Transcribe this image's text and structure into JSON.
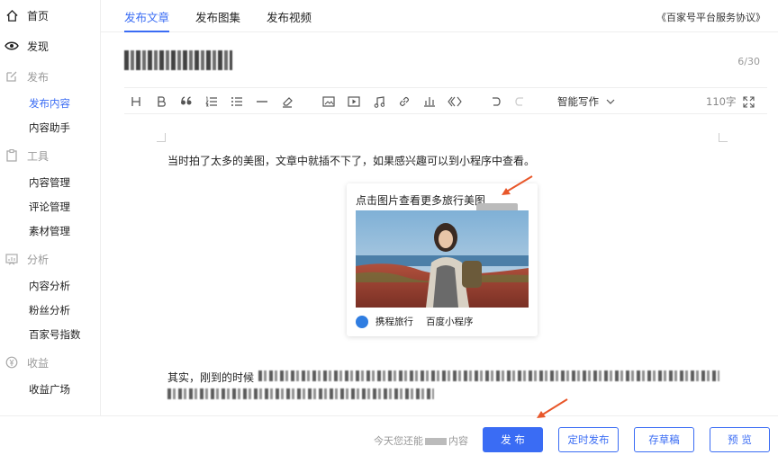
{
  "sidebar": {
    "home": "首页",
    "discover": "发现",
    "publish": {
      "group": "发布",
      "items": [
        "发布内容",
        "内容助手"
      ]
    },
    "tools": {
      "group": "工具",
      "items": [
        "内容管理",
        "评论管理",
        "素材管理"
      ]
    },
    "analytics": {
      "group": "分析",
      "items": [
        "内容分析",
        "粉丝分析",
        "百家号指数"
      ]
    },
    "income": {
      "group": "收益",
      "items": [
        "收益广场"
      ]
    }
  },
  "tabs": [
    "发布文章",
    "发布图集",
    "发布视频"
  ],
  "agreement_link": "《百家号平台服务协议》",
  "title": {
    "counter": "6/30"
  },
  "toolbar": {
    "smart_writing": "智能写作",
    "word_count": "110字"
  },
  "article": {
    "paragraph1": "当时拍了太多的美图，文章中就插不下了，如果感兴趣可以到小程序中查看。",
    "paragraph2_start": "其实，刚到的时候",
    "card": {
      "title": "点击图片查看更多旅行美图",
      "source": "携程旅行",
      "platform": "百度小程序"
    }
  },
  "bottom": {
    "summary_prefix": "今天您还能",
    "summary_suffix": "内容",
    "publish": "发 布",
    "schedule": "定时发布",
    "draft": "存草稿",
    "preview": "预 览"
  },
  "colors": {
    "accent": "#3a6cf4",
    "arrow": "#e8572a"
  }
}
